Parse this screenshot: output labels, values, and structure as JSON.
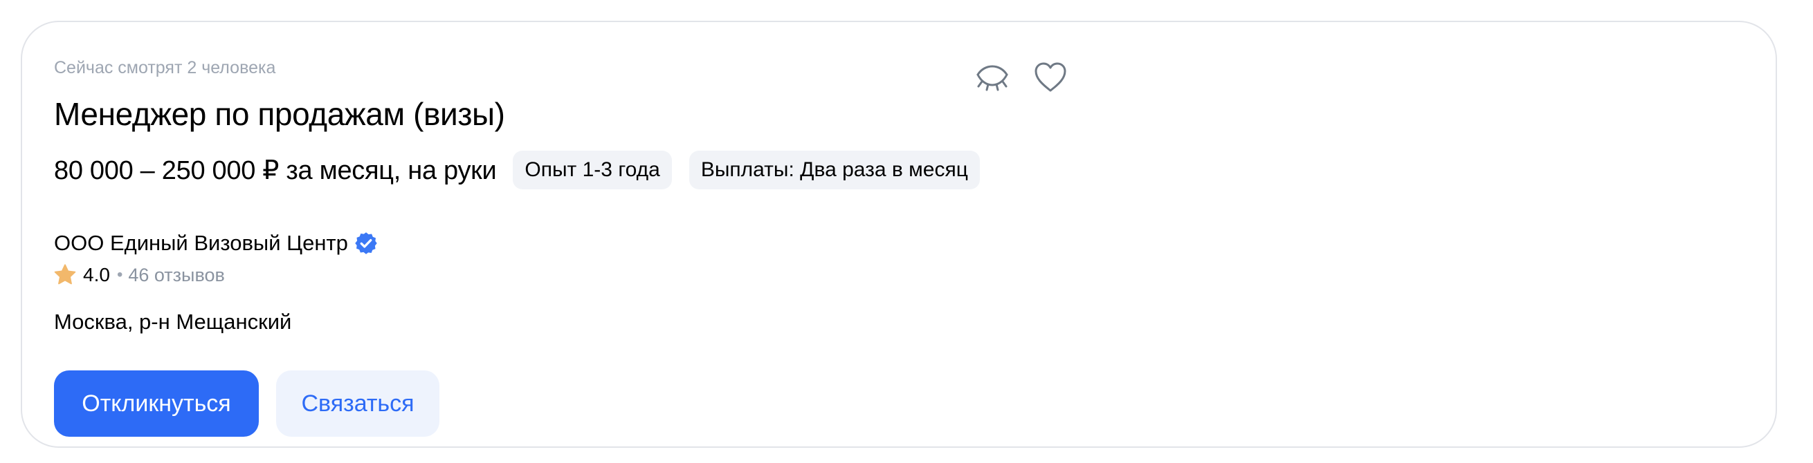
{
  "vacancy": {
    "viewers_text": "Сейчас смотрят 2 человека",
    "title": "Менеджер по продажам (визы)",
    "salary": "80 000 – 250 000 ₽ за месяц, на руки",
    "tags": [
      {
        "label": "Опыт 1-3 года"
      },
      {
        "label": "Выплаты: Два раза в месяц"
      }
    ],
    "company": {
      "name": "ООО Единый Визовый Центр",
      "verified_icon": "verified-badge-icon",
      "rating": "4.0",
      "rating_icon": "star-icon",
      "reviews": "46 отзывов"
    },
    "location": "Москва, р-н Мещанский"
  },
  "actions": {
    "apply_label": "Откликнуться",
    "contact_label": "Связаться",
    "hide_icon": "eye-closed-icon",
    "favorite_icon": "heart-icon"
  },
  "colors": {
    "primary": "#2d6bf6",
    "secondary_bg": "#eef3fd",
    "tag_bg": "#f1f3f7",
    "muted_text": "#9ea6b2",
    "star": "#f2b86b",
    "verified": "#3b78f5",
    "icon": "#6f7985",
    "border": "#e2e4e9"
  }
}
